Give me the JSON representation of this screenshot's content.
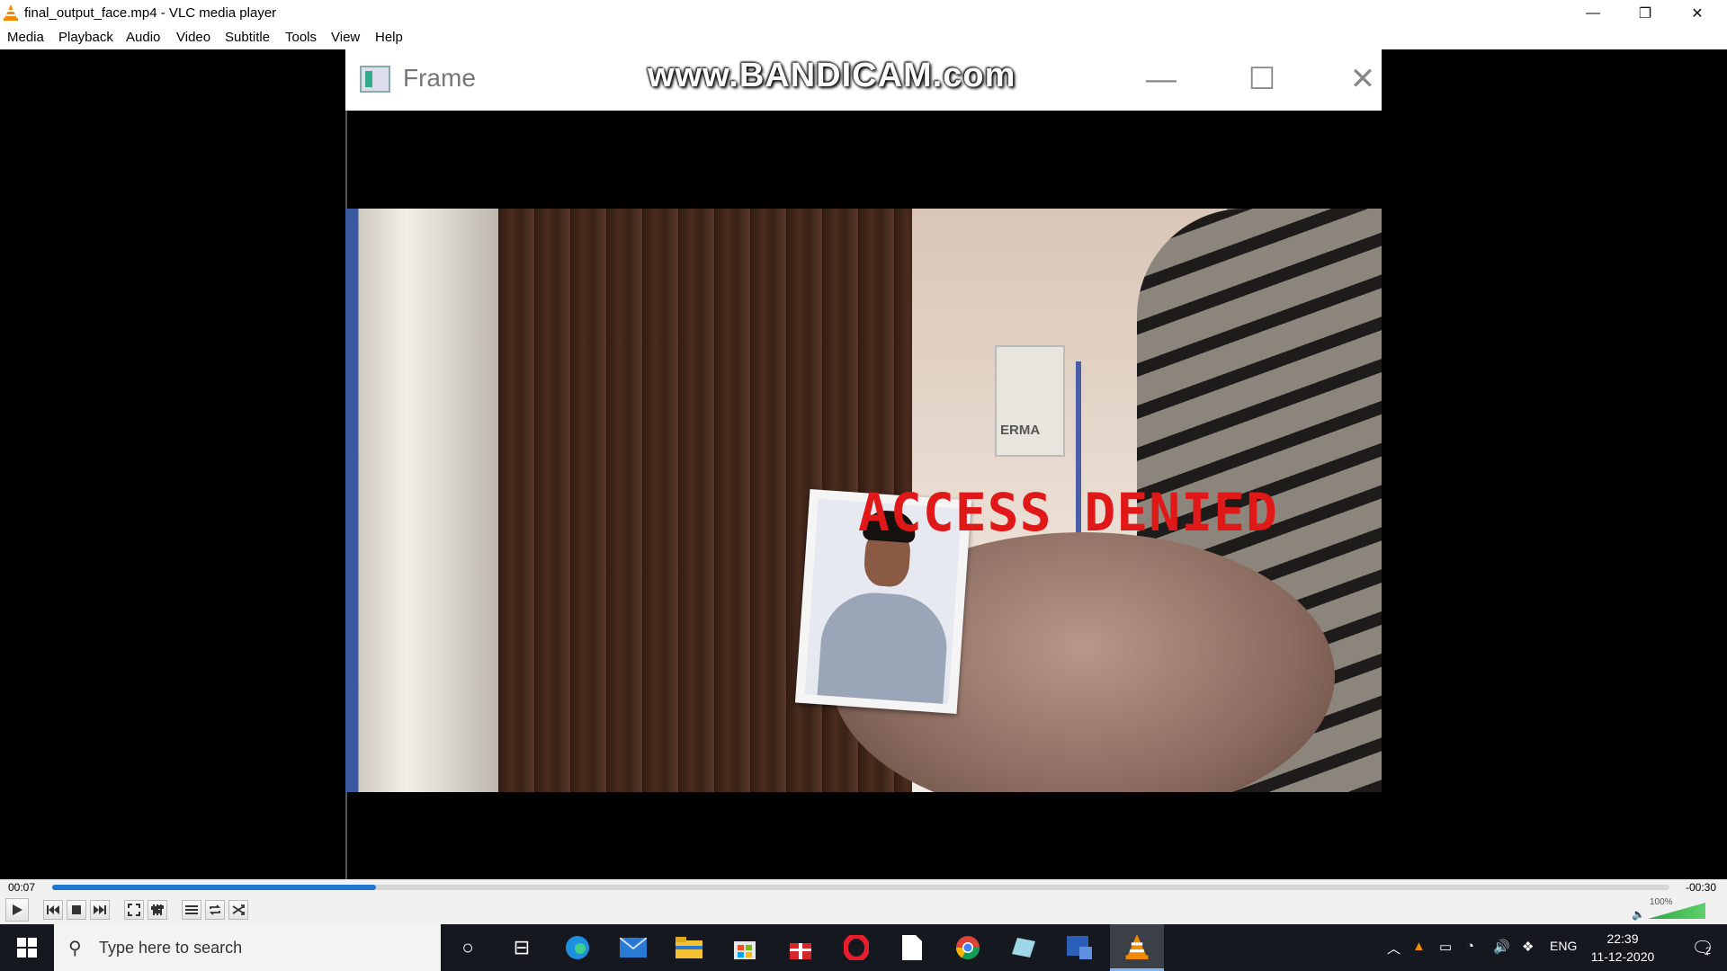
{
  "window": {
    "title": "final_output_face.mp4 - VLC media player",
    "controls": [
      "—",
      "❐",
      "✕"
    ]
  },
  "menu": [
    "Media",
    "Playback",
    "Audio",
    "Video",
    "Subtitle",
    "Tools",
    "View",
    "Help"
  ],
  "frame_window": {
    "title": "Frame",
    "watermark": "www.BANDICAM.com",
    "controls": [
      "—",
      "☐",
      "✕"
    ]
  },
  "video": {
    "overlay_text": "ACCESS DENIED",
    "wall_switch_label": "ERMA"
  },
  "player": {
    "elapsed": "00:07",
    "remaining": "-00:30",
    "progress_fraction": 0.2,
    "volume_label": "100%"
  },
  "taskbar": {
    "search_placeholder": "Type here to search",
    "language": "ENG",
    "time": "22:39",
    "date": "11-12-2020",
    "notification_count": "2"
  },
  "colors": {
    "seek_fill": "#1f77d0",
    "overlay_red": "#e01818",
    "taskbar_bg": "#15191f"
  }
}
